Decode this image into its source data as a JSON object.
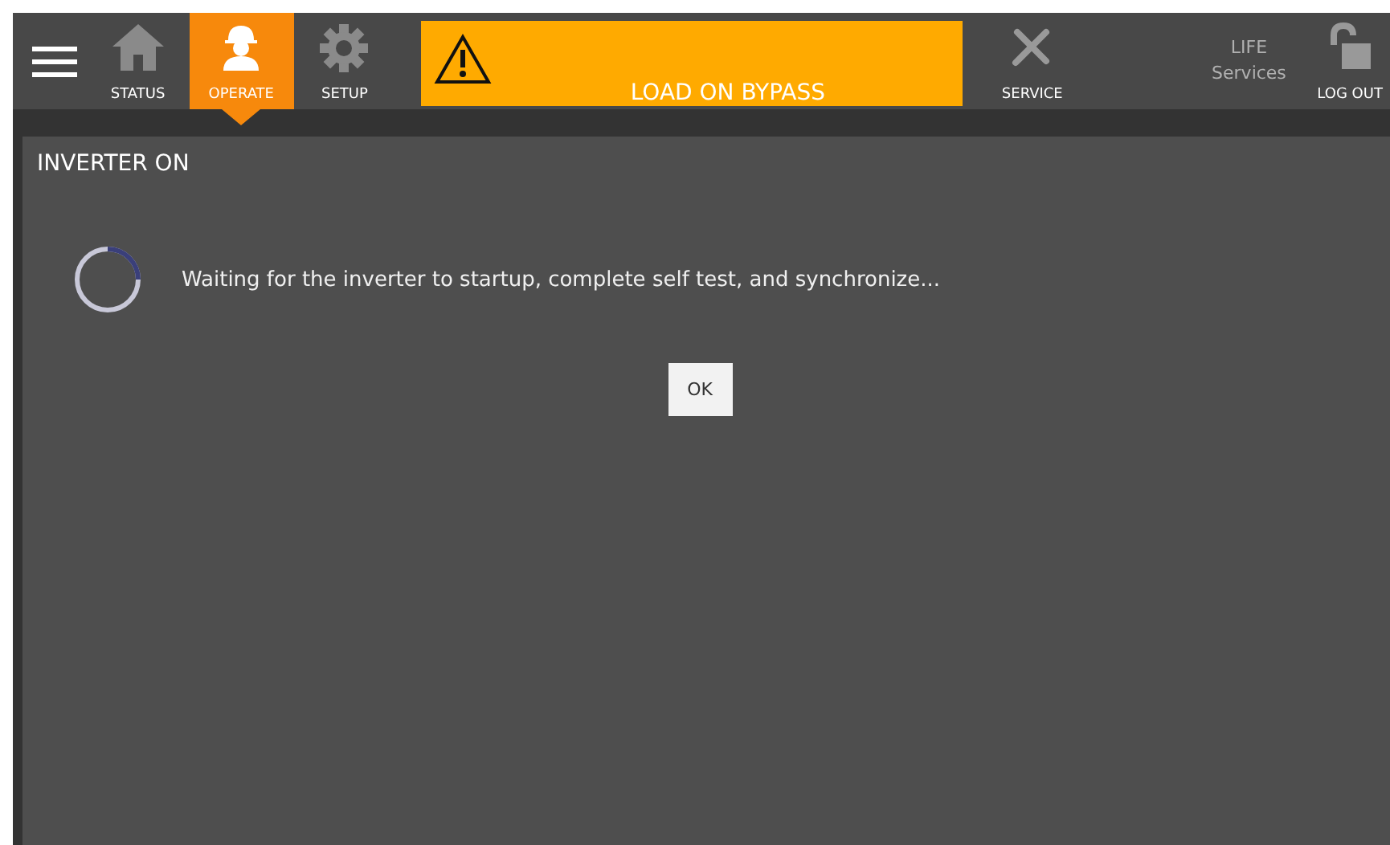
{
  "nav": [
    {
      "label": "STATUS",
      "selected": false
    },
    {
      "label": "OPERATE",
      "selected": true
    },
    {
      "label": "SETUP",
      "selected": false
    }
  ],
  "alarm_banner": {
    "text": "LOAD ON BYPASS"
  },
  "service": {
    "label": "SERVICE"
  },
  "life": {
    "line1": "LIFE",
    "line2": "Services"
  },
  "logout": {
    "label": "LOG OUT"
  },
  "dialog": {
    "title": "INVERTER ON",
    "message": "Waiting for the inverter to startup, complete self test, and synchronize...",
    "button": "OK"
  }
}
